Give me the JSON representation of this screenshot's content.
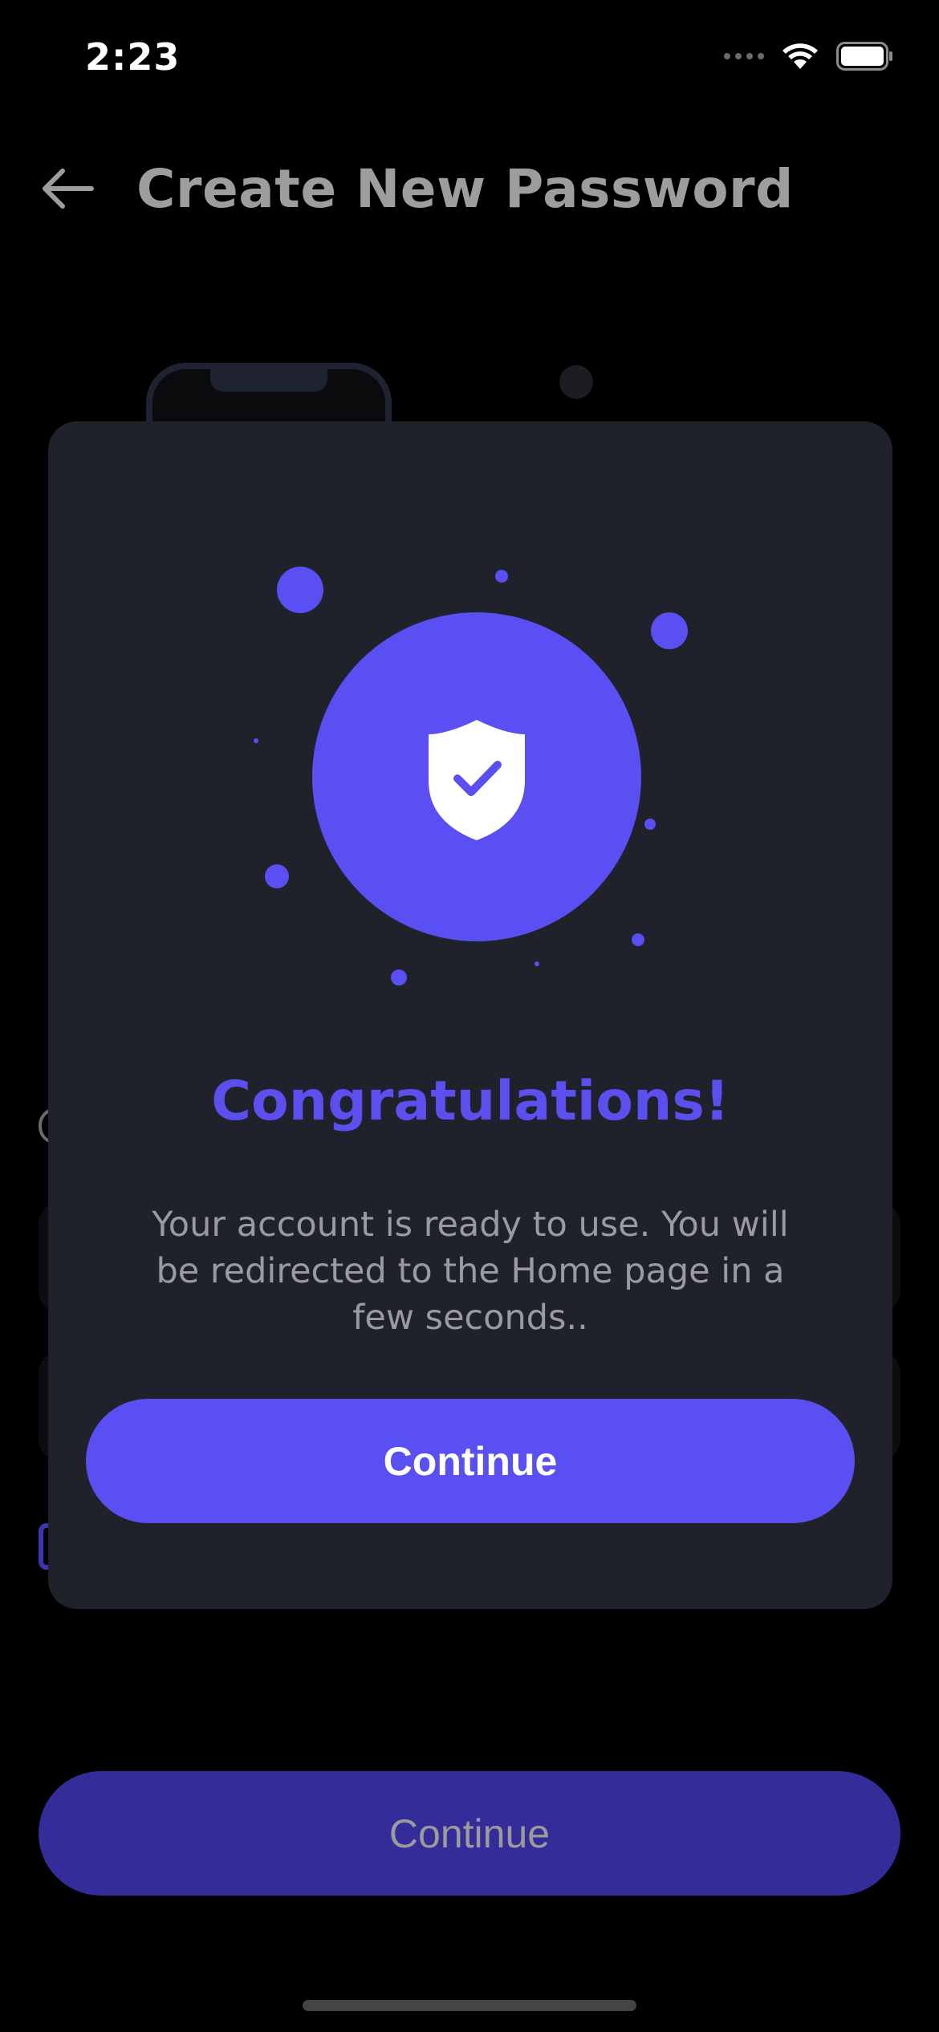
{
  "status_bar": {
    "time": "2:23",
    "icons": [
      "cellular-signal-icon",
      "wifi-icon",
      "battery-icon"
    ]
  },
  "header": {
    "back_icon": "arrow-left-icon",
    "title": "Create New Password"
  },
  "background": {
    "continue_label": "Continue"
  },
  "modal": {
    "icon": "shield-check-icon",
    "title": "Congratulations!",
    "message": "Your account is ready to use. You will be redirected to the Home page in a few seconds..",
    "continue_label": "Continue"
  },
  "colors": {
    "accent": "#5a4ff3",
    "accent_dim": "#342c99",
    "modal_bg": "#20222b",
    "page_bg": "#000000",
    "muted_text": "#9a9aa0"
  }
}
